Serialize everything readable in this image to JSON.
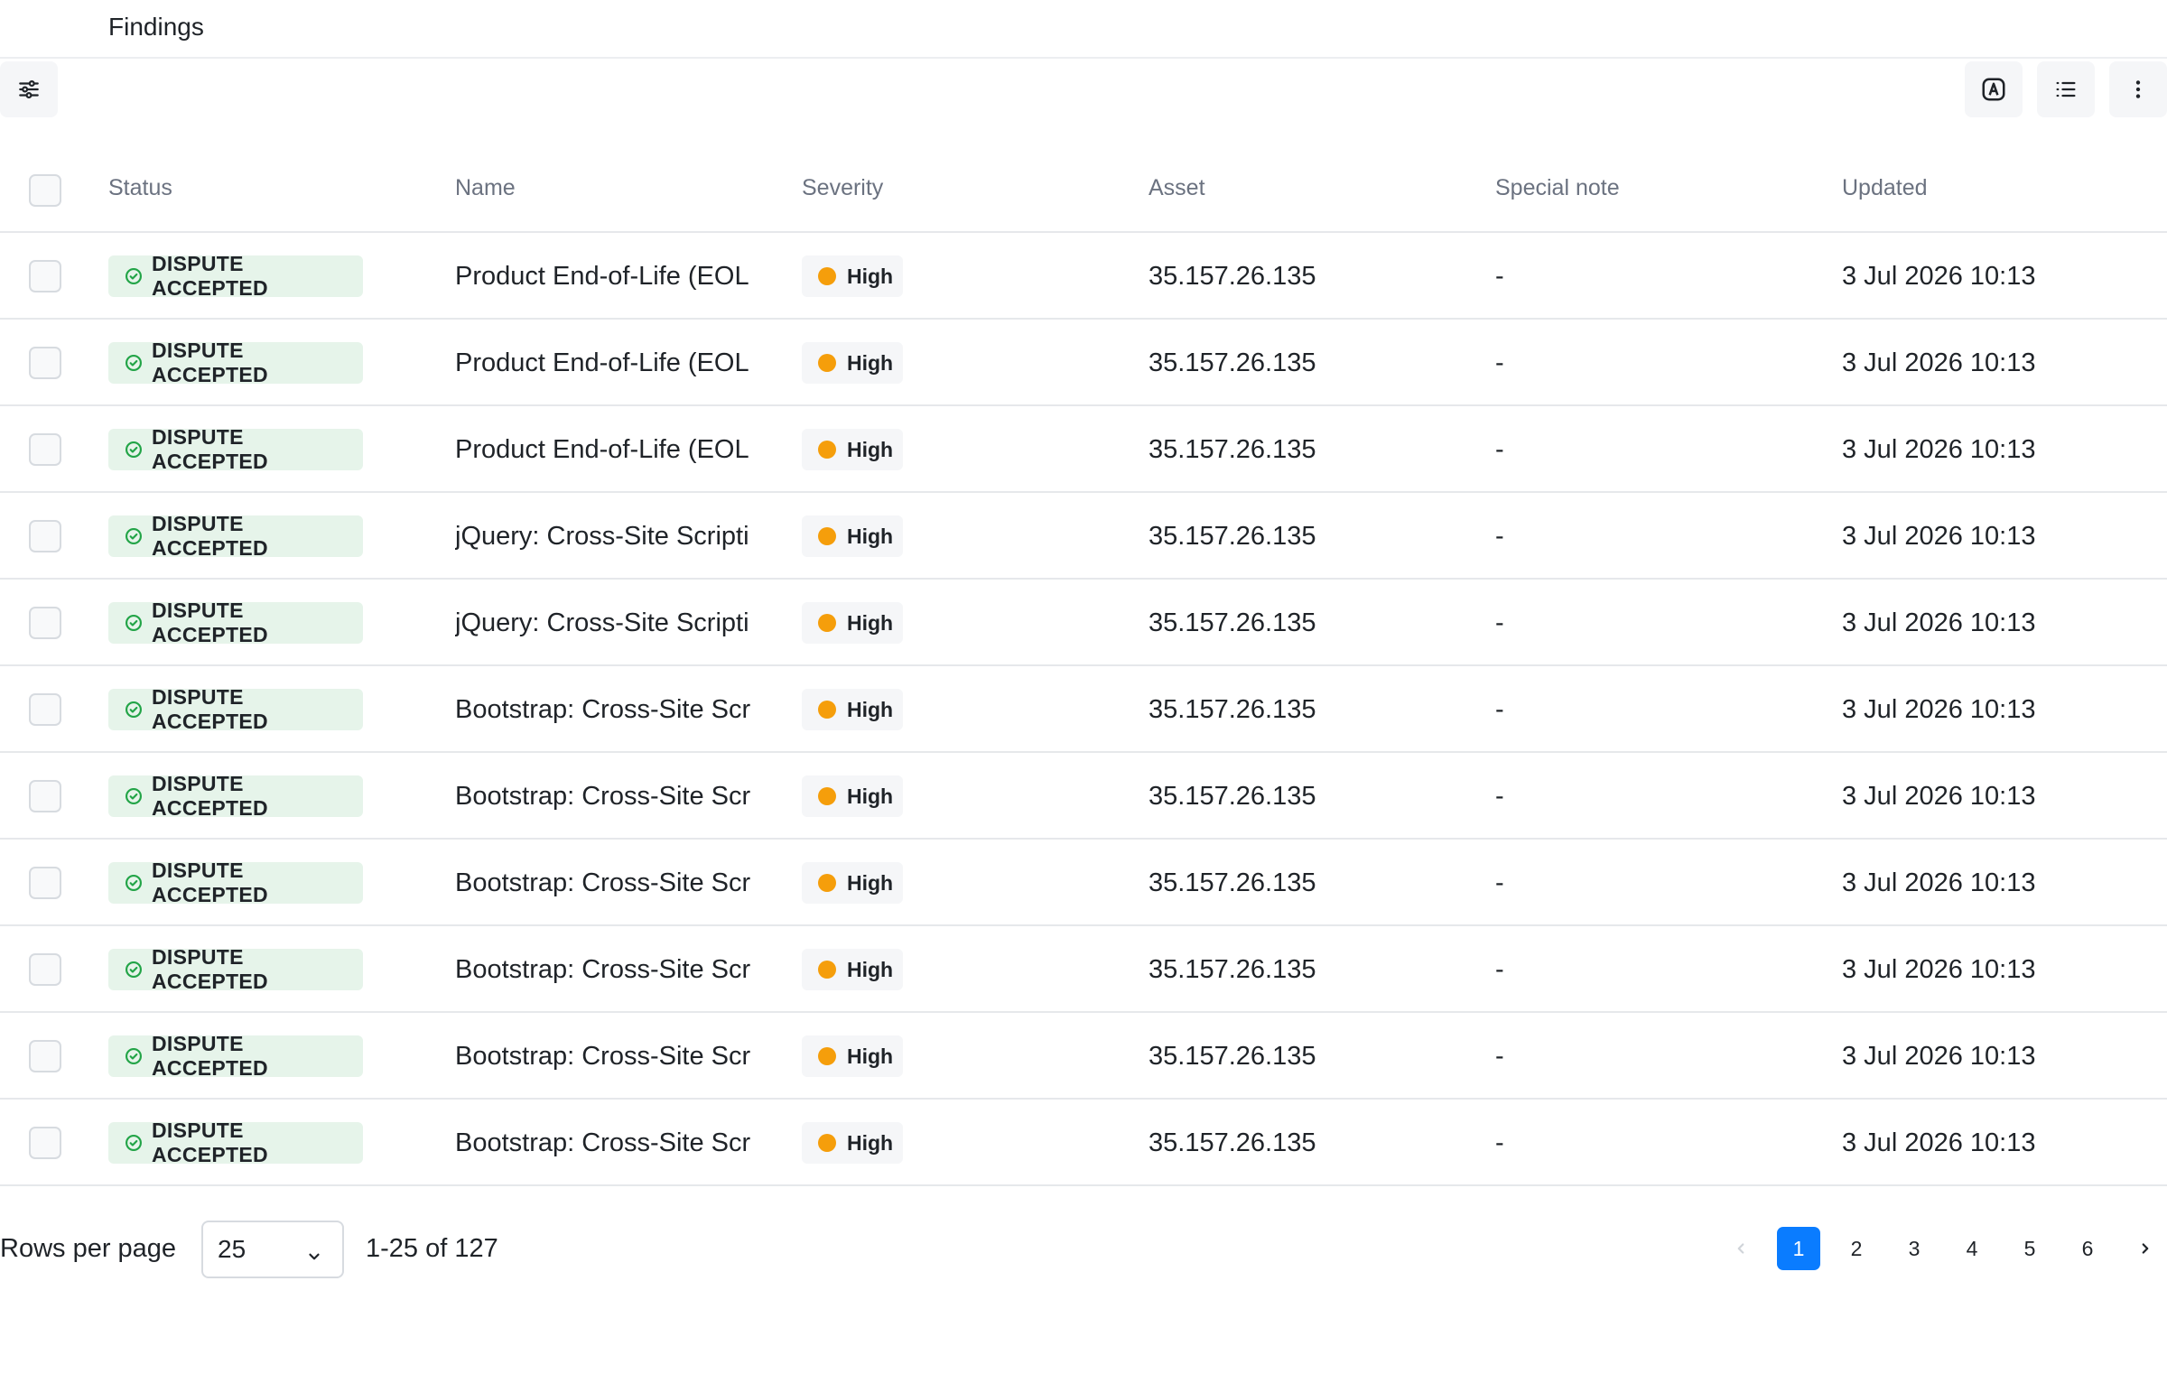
{
  "header": {
    "title": "Findings"
  },
  "toolbar": {
    "filter_icon": "sliders-icon",
    "right_icons": [
      "auto-icon",
      "list-icon",
      "more-vertical-icon"
    ]
  },
  "table": {
    "columns": {
      "status": "Status",
      "name": "Name",
      "severity": "Severity",
      "asset": "Asset",
      "special_note": "Special note",
      "updated": "Updated"
    },
    "rows": [
      {
        "status": "DISPUTE ACCEPTED",
        "name": "Product End-of-Life (EOL",
        "severity": "High",
        "asset": "35.157.26.135",
        "special_note": "-",
        "updated": "3 Jul 2026 10:13"
      },
      {
        "status": "DISPUTE ACCEPTED",
        "name": "Product End-of-Life (EOL",
        "severity": "High",
        "asset": "35.157.26.135",
        "special_note": "-",
        "updated": "3 Jul 2026 10:13"
      },
      {
        "status": "DISPUTE ACCEPTED",
        "name": "Product End-of-Life (EOL",
        "severity": "High",
        "asset": "35.157.26.135",
        "special_note": "-",
        "updated": "3 Jul 2026 10:13"
      },
      {
        "status": "DISPUTE ACCEPTED",
        "name": "jQuery: Cross-Site Scripti",
        "severity": "High",
        "asset": "35.157.26.135",
        "special_note": "-",
        "updated": "3 Jul 2026 10:13"
      },
      {
        "status": "DISPUTE ACCEPTED",
        "name": "jQuery: Cross-Site Scripti",
        "severity": "High",
        "asset": "35.157.26.135",
        "special_note": "-",
        "updated": "3 Jul 2026 10:13"
      },
      {
        "status": "DISPUTE ACCEPTED",
        "name": "Bootstrap: Cross-Site Scr",
        "severity": "High",
        "asset": "35.157.26.135",
        "special_note": "-",
        "updated": "3 Jul 2026 10:13"
      },
      {
        "status": "DISPUTE ACCEPTED",
        "name": "Bootstrap: Cross-Site Scr",
        "severity": "High",
        "asset": "35.157.26.135",
        "special_note": "-",
        "updated": "3 Jul 2026 10:13"
      },
      {
        "status": "DISPUTE ACCEPTED",
        "name": "Bootstrap: Cross-Site Scr",
        "severity": "High",
        "asset": "35.157.26.135",
        "special_note": "-",
        "updated": "3 Jul 2026 10:13"
      },
      {
        "status": "DISPUTE ACCEPTED",
        "name": "Bootstrap: Cross-Site Scr",
        "severity": "High",
        "asset": "35.157.26.135",
        "special_note": "-",
        "updated": "3 Jul 2026 10:13"
      },
      {
        "status": "DISPUTE ACCEPTED",
        "name": "Bootstrap: Cross-Site Scr",
        "severity": "High",
        "asset": "35.157.26.135",
        "special_note": "-",
        "updated": "3 Jul 2026 10:13"
      },
      {
        "status": "DISPUTE ACCEPTED",
        "name": "Bootstrap: Cross-Site Scr",
        "severity": "High",
        "asset": "35.157.26.135",
        "special_note": "-",
        "updated": "3 Jul 2026 10:13"
      }
    ]
  },
  "pagination": {
    "rows_per_page_label": "Rows per page",
    "rows_per_page_value": "25",
    "range_text": "1-25 of 127",
    "pages": [
      "1",
      "2",
      "3",
      "4",
      "5",
      "6"
    ],
    "current_page": "1"
  },
  "colors": {
    "accent": "#0a7cff",
    "status_bg": "#e6f4ea",
    "status_icon": "#22a447",
    "severity_high": "#f59e0b"
  }
}
